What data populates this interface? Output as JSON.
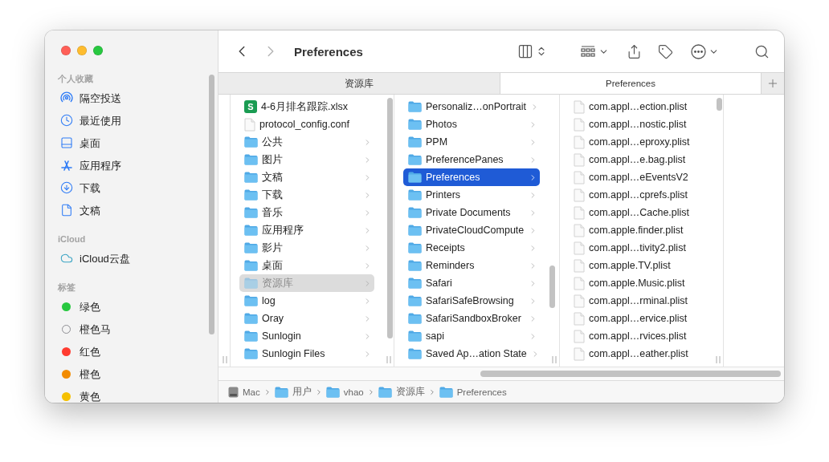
{
  "window": {
    "title": "Preferences",
    "back_enabled": true,
    "forward_enabled": false
  },
  "sidebar": {
    "sections": [
      {
        "title": "个人收藏",
        "items": [
          {
            "label": "隔空投送",
            "kind": "airdrop"
          },
          {
            "label": "最近使用",
            "kind": "recent"
          },
          {
            "label": "桌面",
            "kind": "desktop"
          },
          {
            "label": "应用程序",
            "kind": "apps"
          },
          {
            "label": "下载",
            "kind": "downloads"
          },
          {
            "label": "文稿",
            "kind": "document"
          }
        ]
      },
      {
        "title": "iCloud",
        "items": [
          {
            "label": "iCloud云盘",
            "kind": "cloud"
          }
        ]
      },
      {
        "title": "标签",
        "items": [
          {
            "label": "绿色",
            "kind": "tag",
            "color": "#28c840"
          },
          {
            "label": "橙色马",
            "kind": "tag-outline",
            "color": "#8e8e93"
          },
          {
            "label": "红色",
            "kind": "tag",
            "color": "#ff3b30"
          },
          {
            "label": "橙色",
            "kind": "tag",
            "color": "#f28b00"
          },
          {
            "label": "黄色",
            "kind": "tag",
            "color": "#f5c000"
          }
        ]
      }
    ]
  },
  "tabs": [
    {
      "label": "资源库",
      "selected": false
    },
    {
      "label": "Preferences",
      "selected": true
    }
  ],
  "columns": [
    {
      "focused": false,
      "items": [
        {
          "label": "4-6月排名跟踪.xlsx",
          "kind": "spreadsheet",
          "icon_letter": "S",
          "has_children": false,
          "selected": false,
          "hidden": false
        },
        {
          "label": "protocol_config.conf",
          "kind": "file",
          "has_children": false,
          "selected": false,
          "hidden": false
        },
        {
          "label": "公共",
          "kind": "folder",
          "has_children": true,
          "selected": false,
          "hidden": false
        },
        {
          "label": "图片",
          "kind": "folder",
          "has_children": true,
          "selected": false,
          "hidden": false
        },
        {
          "label": "文稿",
          "kind": "folder",
          "has_children": true,
          "selected": false,
          "hidden": false
        },
        {
          "label": "下载",
          "kind": "folder",
          "has_children": true,
          "selected": false,
          "hidden": false
        },
        {
          "label": "音乐",
          "kind": "folder",
          "has_children": true,
          "selected": false,
          "hidden": false
        },
        {
          "label": "应用程序",
          "kind": "folder",
          "has_children": true,
          "selected": false,
          "hidden": false
        },
        {
          "label": "影片",
          "kind": "folder",
          "has_children": true,
          "selected": false,
          "hidden": false
        },
        {
          "label": "桌面",
          "kind": "folder",
          "has_children": true,
          "selected": false,
          "hidden": false
        },
        {
          "label": "资源库",
          "kind": "folder",
          "has_children": true,
          "selected": true,
          "hidden": true
        },
        {
          "label": "log",
          "kind": "folder",
          "has_children": true,
          "selected": false,
          "hidden": false
        },
        {
          "label": "Oray",
          "kind": "folder",
          "has_children": true,
          "selected": false,
          "hidden": false
        },
        {
          "label": "Sunlogin",
          "kind": "folder",
          "has_children": true,
          "selected": false,
          "hidden": false
        },
        {
          "label": "Sunlogin Files",
          "kind": "folder",
          "has_children": true,
          "selected": false,
          "hidden": false
        }
      ]
    },
    {
      "focused": true,
      "items": [
        {
          "label": "Personaliz…onPortrait",
          "kind": "folder",
          "has_children": true,
          "selected": false,
          "hidden": false
        },
        {
          "label": "Photos",
          "kind": "folder",
          "has_children": true,
          "selected": false,
          "hidden": false
        },
        {
          "label": "PPM",
          "kind": "folder",
          "has_children": true,
          "selected": false,
          "hidden": false
        },
        {
          "label": "PreferencePanes",
          "kind": "folder",
          "has_children": true,
          "selected": false,
          "hidden": false
        },
        {
          "label": "Preferences",
          "kind": "folder",
          "has_children": true,
          "selected": true,
          "hidden": false
        },
        {
          "label": "Printers",
          "kind": "folder",
          "has_children": true,
          "selected": false,
          "hidden": false
        },
        {
          "label": "Private Documents",
          "kind": "folder",
          "has_children": true,
          "selected": false,
          "hidden": false
        },
        {
          "label": "PrivateCloudCompute",
          "kind": "folder",
          "has_children": true,
          "selected": false,
          "hidden": false
        },
        {
          "label": "Receipts",
          "kind": "folder",
          "has_children": true,
          "selected": false,
          "hidden": false
        },
        {
          "label": "Reminders",
          "kind": "folder",
          "has_children": true,
          "selected": false,
          "hidden": false
        },
        {
          "label": "Safari",
          "kind": "folder",
          "has_children": true,
          "selected": false,
          "hidden": false
        },
        {
          "label": "SafariSafeBrowsing",
          "kind": "folder",
          "has_children": true,
          "selected": false,
          "hidden": false
        },
        {
          "label": "SafariSandboxBroker",
          "kind": "folder",
          "has_children": true,
          "selected": false,
          "hidden": false
        },
        {
          "label": "sapi",
          "kind": "folder",
          "has_children": true,
          "selected": false,
          "hidden": false
        },
        {
          "label": "Saved Ap…ation State",
          "kind": "folder",
          "has_children": true,
          "selected": false,
          "hidden": false
        }
      ]
    },
    {
      "items": [
        {
          "label": "com.appl…ection.plist",
          "kind": "file",
          "has_children": false,
          "selected": false,
          "hidden": false
        },
        {
          "label": "com.appl…nostic.plist",
          "kind": "file",
          "has_children": false,
          "selected": false,
          "hidden": false
        },
        {
          "label": "com.appl…eproxy.plist",
          "kind": "file",
          "has_children": false,
          "selected": false,
          "hidden": false
        },
        {
          "label": "com.appl…e.bag.plist",
          "kind": "file",
          "has_children": false,
          "selected": false,
          "hidden": false
        },
        {
          "label": "com.appl…eEventsV2",
          "kind": "file",
          "has_children": false,
          "selected": false,
          "hidden": false
        },
        {
          "label": "com.appl…cprefs.plist",
          "kind": "file",
          "has_children": false,
          "selected": false,
          "hidden": false
        },
        {
          "label": "com.appl…Cache.plist",
          "kind": "file",
          "has_children": false,
          "selected": false,
          "hidden": false
        },
        {
          "label": "com.apple.finder.plist",
          "kind": "file",
          "has_children": false,
          "selected": false,
          "hidden": false
        },
        {
          "label": "com.appl…tivity2.plist",
          "kind": "file",
          "has_children": false,
          "selected": false,
          "hidden": false
        },
        {
          "label": "com.apple.TV.plist",
          "kind": "file",
          "has_children": false,
          "selected": false,
          "hidden": false
        },
        {
          "label": "com.apple.Music.plist",
          "kind": "file",
          "has_children": false,
          "selected": false,
          "hidden": false
        },
        {
          "label": "com.appl…rminal.plist",
          "kind": "file",
          "has_children": false,
          "selected": false,
          "hidden": false
        },
        {
          "label": "com.appl…ervice.plist",
          "kind": "file",
          "has_children": false,
          "selected": false,
          "hidden": false
        },
        {
          "label": "com.appl…rvices.plist",
          "kind": "file",
          "has_children": false,
          "selected": false,
          "hidden": false
        },
        {
          "label": "com.appl…eather.plist",
          "kind": "file",
          "has_children": false,
          "selected": false,
          "hidden": false
        }
      ]
    }
  ],
  "path_bar": [
    {
      "label": "Mac",
      "kind": "disk"
    },
    {
      "label": "用户",
      "kind": "folder"
    },
    {
      "label": "vhao",
      "kind": "folder"
    },
    {
      "label": "资源库",
      "kind": "folder"
    },
    {
      "label": "Preferences",
      "kind": "folder"
    }
  ]
}
